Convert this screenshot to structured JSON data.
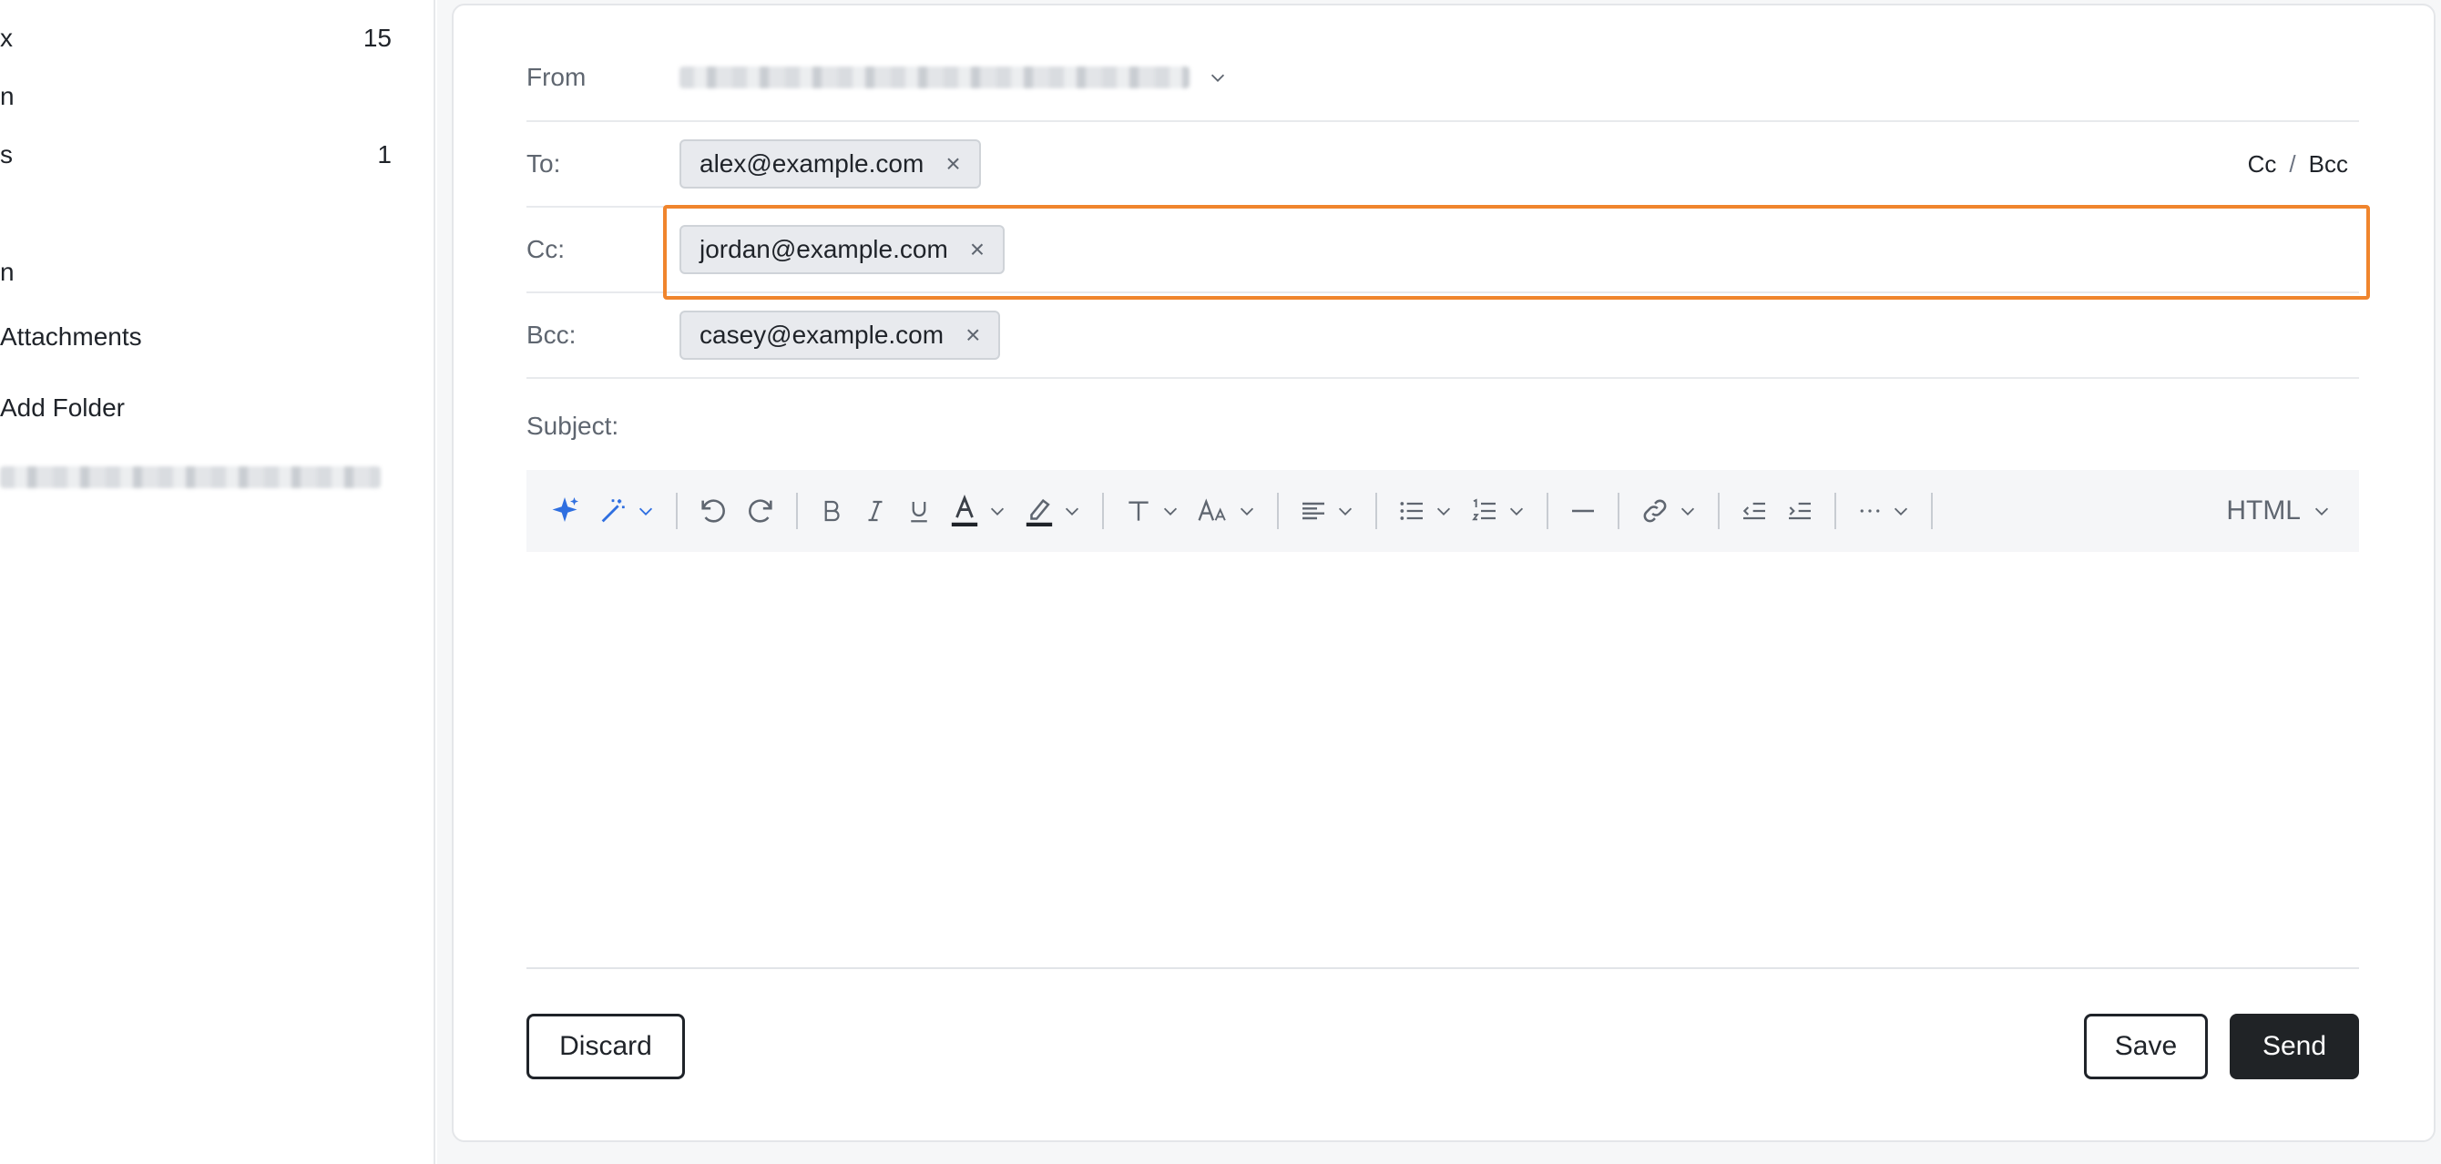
{
  "sidebar": {
    "items": [
      {
        "label": "x",
        "count": "15"
      },
      {
        "label": "n",
        "count": ""
      },
      {
        "label": "s",
        "count": "1"
      },
      {
        "label": "n",
        "count": ""
      },
      {
        "label": "Attachments",
        "count": ""
      },
      {
        "label": "Add Folder",
        "count": ""
      }
    ]
  },
  "compose": {
    "from_label": "From",
    "to_label": "To:",
    "cc_label": "Cc:",
    "bcc_label": "Bcc:",
    "subject_label": "Subject:",
    "subject_value": "",
    "cc_toggle": "Cc",
    "bcc_toggle": "Bcc",
    "toggle_separator": "/",
    "to_recipients": [
      "alex@example.com"
    ],
    "cc_recipients": [
      "jordan@example.com"
    ],
    "bcc_recipients": [
      "casey@example.com"
    ],
    "chip_remove": "×"
  },
  "toolbar": {
    "format_select": "HTML"
  },
  "actions": {
    "discard": "Discard",
    "save": "Save",
    "send": "Send"
  },
  "colors": {
    "highlight": "#f0852d",
    "ai_icon": "#2f6fe0",
    "send_bg": "#202326"
  }
}
